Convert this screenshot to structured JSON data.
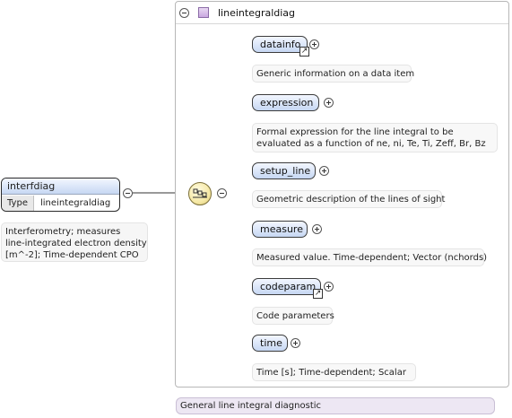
{
  "root": {
    "name": "interfdiag",
    "type_label": "Type",
    "type_value": "lineintegraldiag",
    "annotation": [
      "Interferometry; measures",
      "line-integrated electron density",
      "[m^-2]; Time-dependent CPO"
    ]
  },
  "complex_type": {
    "name": "lineintegraldiag",
    "annotation": "General line integral diagnostic"
  },
  "children": [
    {
      "name": "datainfo",
      "is_reference": true,
      "annotation": [
        "Generic information on a data item"
      ]
    },
    {
      "name": "expression",
      "is_reference": false,
      "annotation": [
        "Formal expression for the line integral to be",
        "evaluated as a function of ne, ni, Te, Ti, Zeff, Br, Bz"
      ]
    },
    {
      "name": "setup_line",
      "is_reference": false,
      "annotation": [
        "Geometric description of the lines of sight"
      ]
    },
    {
      "name": "measure",
      "is_reference": false,
      "annotation": [
        "Measured value. Time-dependent; Vector (nchords)"
      ]
    },
    {
      "name": "codeparam",
      "is_reference": true,
      "annotation": [
        "Code parameters"
      ]
    },
    {
      "name": "time",
      "is_reference": false,
      "annotation": [
        "Time [s]; Time-dependent; Scalar"
      ]
    }
  ],
  "colors": {
    "element_fill": "#c6d7f3",
    "compositor_fill": "#f6e9a6",
    "type_annotation_fill": "#ede7f3"
  },
  "icons": {
    "collapse": "minus-circle-icon",
    "expand": "plus-circle-icon",
    "reference": "arrow-link-icon",
    "complex_type": "complex-type-icon",
    "sequence": "sequence-compositor-icon"
  }
}
